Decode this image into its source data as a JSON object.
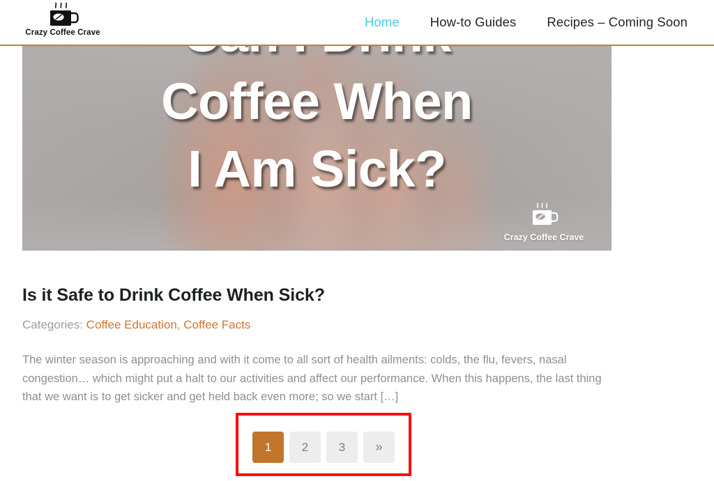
{
  "site": {
    "brand_name": "Crazy Coffee Crave",
    "brand_icon": "coffee-mug-icon",
    "accent_orange": "#d07a2c",
    "accent_cyan": "#46cde4",
    "link_orange": "#cf7630"
  },
  "nav": {
    "items": [
      {
        "label": "Home",
        "active": true
      },
      {
        "label": "How-to Guides",
        "active": false
      },
      {
        "label": "Recipes – Coming Soon",
        "active": false
      }
    ]
  },
  "hero": {
    "headline_line1": "Can I Drink",
    "headline_line2": "Coffee When",
    "headline_line3": "I Am Sick?",
    "watermark_name": "Crazy Coffee Crave",
    "watermark_icon": "coffee-mug-icon"
  },
  "article": {
    "title": "Is it Safe to Drink Coffee When Sick?",
    "categories_label": "Categories:",
    "categories": [
      {
        "label": "Coffee Education"
      },
      {
        "label": "Coffee Facts"
      }
    ],
    "categories_separator": ", ",
    "excerpt": "The winter season is approaching and with it come to all sort of health ailments: colds, the flu, fevers, nasal congestion… which might put a halt to our activities and affect our performance. When this happens, the last thing that we want is to get sicker and get held back even more; so we start […]"
  },
  "pagination": {
    "items": [
      {
        "label": "1",
        "current": true
      },
      {
        "label": "2",
        "current": false
      },
      {
        "label": "3",
        "current": false
      },
      {
        "label": "»",
        "current": false
      }
    ],
    "highlight_color": "#fc0d0d",
    "active_color": "#c2762b"
  }
}
